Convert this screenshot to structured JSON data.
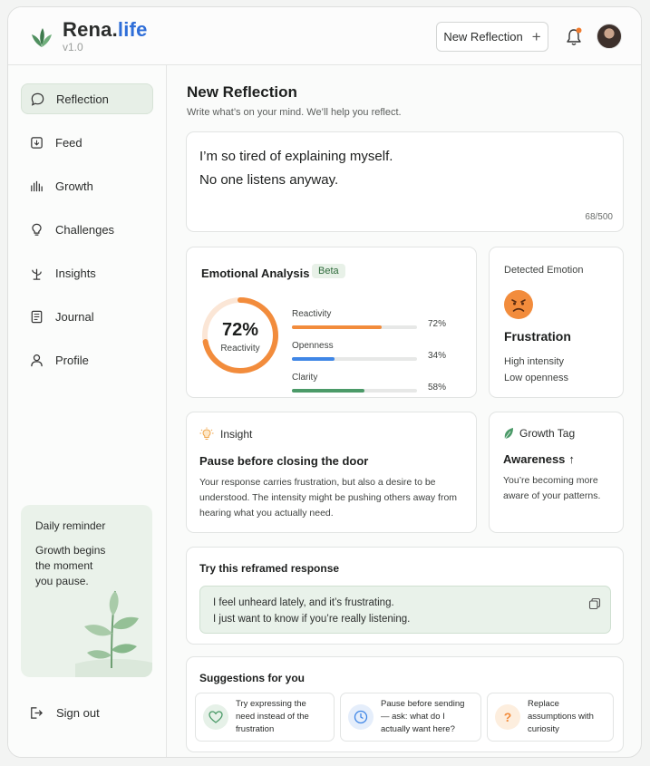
{
  "header": {
    "brand_part1": "Rena.",
    "brand_part2": "life",
    "version": "v1.0",
    "new_reflection_label": "New Reflection",
    "brand_color": "#2f6ed8",
    "notification_dot_color": "#f07b2e"
  },
  "sidebar": {
    "items": [
      {
        "label": "Reflection",
        "icon": "chat-bubble-icon",
        "active": true
      },
      {
        "label": "Feed",
        "icon": "feed-icon",
        "active": false
      },
      {
        "label": "Growth",
        "icon": "bar-chart-icon",
        "active": false
      },
      {
        "label": "Challenges",
        "icon": "lightbulb-icon",
        "active": false
      },
      {
        "label": "Insights",
        "icon": "plant-icon",
        "active": false
      },
      {
        "label": "Journal",
        "icon": "journal-icon",
        "active": false
      },
      {
        "label": "Profile",
        "icon": "person-icon",
        "active": false
      }
    ],
    "reminder_title": "Daily reminder",
    "reminder_text": "Growth begins the moment you pause.",
    "sign_out_label": "Sign out"
  },
  "main": {
    "title": "New Reflection",
    "subtitle": "Write what’s on your mind. We’ll help you reflect.",
    "input_line1": "I’m so tired of explaining myself.",
    "input_line2": "No one listens anyway.",
    "char_count": "68/500"
  },
  "analysis": {
    "title": "Emotional Analysis",
    "badge": "Beta",
    "gauge_value": "72%",
    "gauge_label": "Reactivity",
    "gauge_fraction": 0.72,
    "metrics": [
      {
        "label": "Reactivity",
        "value": "72%",
        "fraction": 0.72,
        "color": "#f28c3c"
      },
      {
        "label": "Openness",
        "value": "34%",
        "fraction": 0.34,
        "color": "#3f86e6"
      },
      {
        "label": "Clarity",
        "value": "58%",
        "fraction": 0.58,
        "color": "#4b9a68"
      }
    ]
  },
  "detected": {
    "title": "Detected Emotion",
    "emotion": "Frustration",
    "detail1": "High intensity",
    "detail2": "Low openness",
    "face_color": "#f28c3c"
  },
  "insight": {
    "label": "Insight",
    "title": "Pause before closing the door",
    "text": "Your response carries frustration, but also a desire to be understood. The intensity might be pushing others away from hearing what you actually need."
  },
  "growth_tag": {
    "label": "Growth Tag",
    "title": "Awareness",
    "arrow": "↑",
    "text": "You’re becoming more aware of your patterns."
  },
  "reframe": {
    "title": "Try this reframed response",
    "line1": "I feel unheard lately, and it’s frustrating.",
    "line2": "I just want to know if you’re really listening."
  },
  "suggestions": {
    "title": "Suggestions for you",
    "items": [
      {
        "text": "Try expressing the need instead of the frustration",
        "icon": "heart-icon"
      },
      {
        "text": "Pause before sending — ask: what do I actually want here?",
        "icon": "clock-icon"
      },
      {
        "text": "Replace assumptions with curiosity",
        "icon": "question-icon"
      }
    ]
  }
}
